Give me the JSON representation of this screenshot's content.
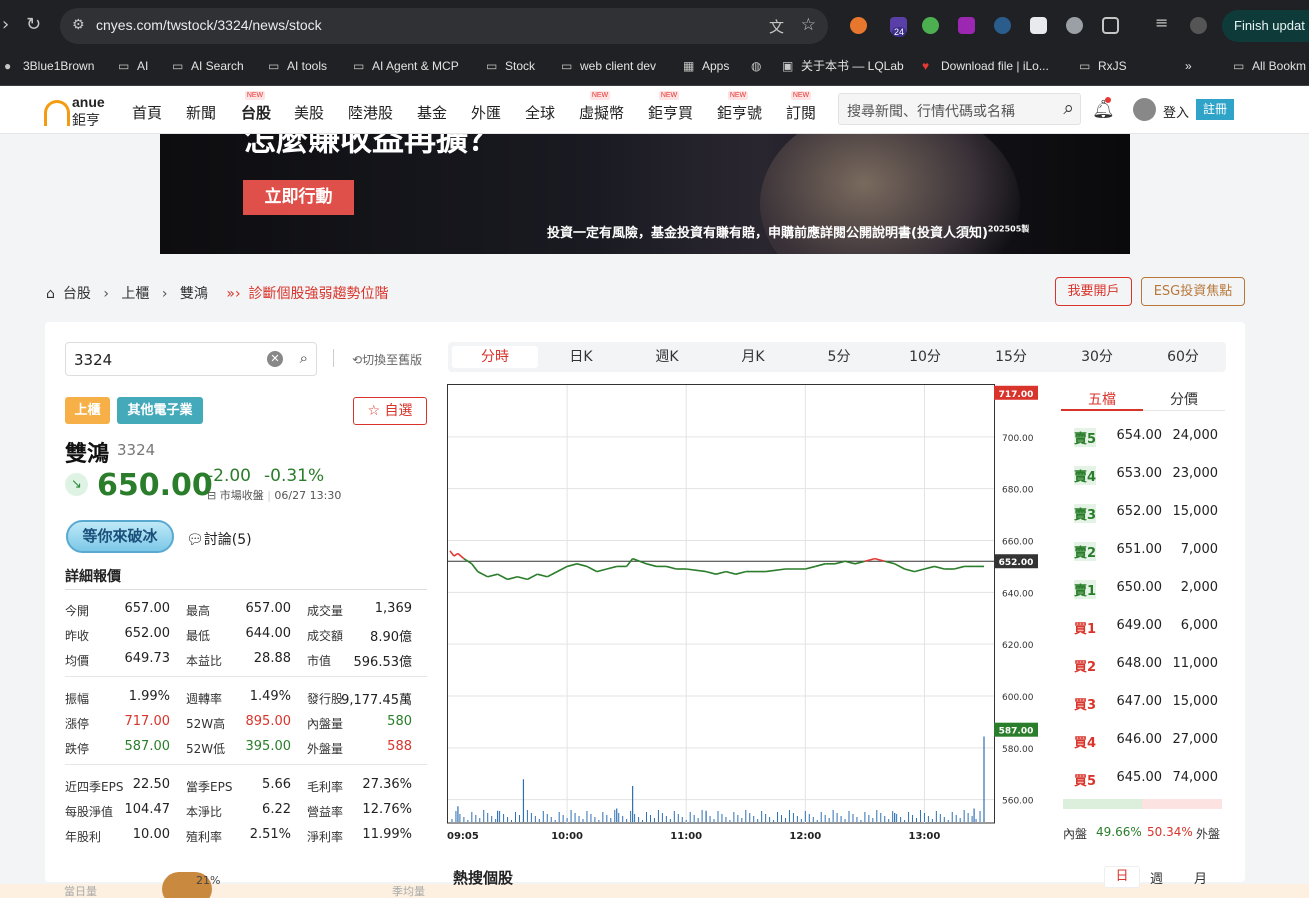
{
  "browser": {
    "url": "cnyes.com/twstock/3324/news/stock",
    "update_label": "Finish updat",
    "extension_badge": "24",
    "bookmarks": [
      "3Blue1Brown",
      "AI",
      "AI Search",
      "AI tools",
      "AI Agent & MCP",
      "Stock",
      "web client dev",
      "Apps",
      "",
      "关于本书 — LQLab",
      "Download file | iLo...",
      "RxJS",
      "»",
      "All Bookm"
    ]
  },
  "header": {
    "logo_top": "anue",
    "logo_bottom": "鉅亨",
    "menu": [
      "首頁",
      "新聞",
      "台股",
      "美股",
      "陸港股",
      "基金",
      "外匯",
      "全球",
      "虛擬幣",
      "鉅亨買",
      "鉅亨號",
      "訂閱"
    ],
    "new_tag": "NEW",
    "search_placeholder": "搜尋新聞、行情代碼或名稱",
    "login": "登入",
    "register": "註冊"
  },
  "banner": {
    "headline_partial": "怎麼賺收益再擴？",
    "cta": "立即行動",
    "disclaimer": "投資一定有風險，基金投資有賺有賠，申購前應詳閱公開說明書(投資人須知)",
    "disclaimer_sup": "202505製"
  },
  "breadcrumb": {
    "items": [
      "台股",
      "上櫃",
      "雙鴻"
    ],
    "diagnose": "診斷個股強弱趨勢位階",
    "open_account": "我要開戶",
    "esg": "ESG投資焦點"
  },
  "stock": {
    "search_value": "3324",
    "switch_old": "切換至舊版",
    "market_tag": "上櫃",
    "industry_tag": "其他電子業",
    "favorite": "自選",
    "name": "雙鴻",
    "code": "3324",
    "price": "650.00",
    "change": "-2.00",
    "change_pct": "-0.31%",
    "status": "市場收盤",
    "time": "06/27 13:30",
    "ice_badge": "等你來破冰",
    "discussion": "討論(5)",
    "detail_title": "詳細報價"
  },
  "quote_rows": [
    [
      [
        "今開",
        "657.00",
        ""
      ],
      [
        "最高",
        "657.00",
        ""
      ],
      [
        "成交量",
        "1,369",
        ""
      ]
    ],
    [
      [
        "昨收",
        "652.00",
        ""
      ],
      [
        "最低",
        "644.00",
        ""
      ],
      [
        "成交額",
        "8.90億",
        ""
      ]
    ],
    [
      [
        "均價",
        "649.73",
        ""
      ],
      [
        "本益比",
        "28.88",
        ""
      ],
      [
        "市值",
        "596.53億",
        ""
      ]
    ],
    [
      [
        "振幅",
        "1.99%",
        ""
      ],
      [
        "週轉率",
        "1.49%",
        ""
      ],
      [
        "發行股",
        "9,177.45萬",
        ""
      ]
    ],
    [
      [
        "漲停",
        "717.00",
        "red"
      ],
      [
        "52W高",
        "895.00",
        "red"
      ],
      [
        "內盤量",
        "580",
        "green"
      ]
    ],
    [
      [
        "跌停",
        "587.00",
        "green"
      ],
      [
        "52W低",
        "395.00",
        "green"
      ],
      [
        "外盤量",
        "588",
        "red"
      ]
    ],
    [
      [
        "近四季EPS",
        "22.50",
        ""
      ],
      [
        "當季EPS",
        "5.66",
        ""
      ],
      [
        "毛利率",
        "27.36%",
        ""
      ]
    ],
    [
      [
        "每股淨值",
        "104.47",
        ""
      ],
      [
        "本淨比",
        "6.22",
        ""
      ],
      [
        "營益率",
        "12.76%",
        ""
      ]
    ],
    [
      [
        "年股利",
        "10.00",
        ""
      ],
      [
        "殖利率",
        "2.51%",
        ""
      ],
      [
        "淨利率",
        "11.99%",
        ""
      ]
    ]
  ],
  "tabs": [
    "分時",
    "日K",
    "週K",
    "月K",
    "5分",
    "10分",
    "15分",
    "30分",
    "60分"
  ],
  "chart_data": {
    "type": "line",
    "x_ticks": [
      "09:05",
      "10:00",
      "11:00",
      "12:00",
      "13:00"
    ],
    "y_ticks": [
      700,
      680,
      660,
      640,
      620,
      600,
      580,
      560
    ],
    "ylim": [
      551,
      720
    ],
    "ref_price": 652,
    "limit_up": 717,
    "limit_down": 587,
    "ref_label": "652.00",
    "limit_up_label": "717.00",
    "limit_down_label": "587.00",
    "y_tick_labels": [
      "700.00",
      "680.00",
      "660.00",
      "640.00",
      "620.00",
      "600.00",
      "580.00",
      "560.00"
    ],
    "price_series": [
      {
        "t": "09:01",
        "v": 656
      },
      {
        "t": "09:03",
        "v": 654
      },
      {
        "t": "09:05",
        "v": 655
      },
      {
        "t": "09:08",
        "v": 653
      },
      {
        "t": "09:12",
        "v": 651
      },
      {
        "t": "09:15",
        "v": 648
      },
      {
        "t": "09:20",
        "v": 646
      },
      {
        "t": "09:25",
        "v": 647
      },
      {
        "t": "09:30",
        "v": 645
      },
      {
        "t": "09:35",
        "v": 646
      },
      {
        "t": "09:40",
        "v": 645
      },
      {
        "t": "09:45",
        "v": 647
      },
      {
        "t": "09:50",
        "v": 646
      },
      {
        "t": "09:55",
        "v": 648
      },
      {
        "t": "10:00",
        "v": 650
      },
      {
        "t": "10:05",
        "v": 651
      },
      {
        "t": "10:10",
        "v": 650
      },
      {
        "t": "10:15",
        "v": 648
      },
      {
        "t": "10:20",
        "v": 649
      },
      {
        "t": "10:25",
        "v": 650
      },
      {
        "t": "10:30",
        "v": 650
      },
      {
        "t": "10:33",
        "v": 653
      },
      {
        "t": "10:40",
        "v": 651
      },
      {
        "t": "10:45",
        "v": 650
      },
      {
        "t": "10:50",
        "v": 650
      },
      {
        "t": "10:55",
        "v": 649
      },
      {
        "t": "11:00",
        "v": 649
      },
      {
        "t": "11:10",
        "v": 648
      },
      {
        "t": "11:15",
        "v": 647
      },
      {
        "t": "11:20",
        "v": 648
      },
      {
        "t": "11:25",
        "v": 647
      },
      {
        "t": "11:30",
        "v": 648
      },
      {
        "t": "11:40",
        "v": 648
      },
      {
        "t": "11:50",
        "v": 649
      },
      {
        "t": "12:00",
        "v": 649
      },
      {
        "t": "12:05",
        "v": 650
      },
      {
        "t": "12:10",
        "v": 651
      },
      {
        "t": "12:15",
        "v": 651
      },
      {
        "t": "12:20",
        "v": 652
      },
      {
        "t": "12:25",
        "v": 651
      },
      {
        "t": "12:30",
        "v": 652
      },
      {
        "t": "12:35",
        "v": 653
      },
      {
        "t": "12:40",
        "v": 652
      },
      {
        "t": "12:45",
        "v": 651
      },
      {
        "t": "12:50",
        "v": 649
      },
      {
        "t": "12:55",
        "v": 648
      },
      {
        "t": "13:00",
        "v": 649
      },
      {
        "t": "13:05",
        "v": 650
      },
      {
        "t": "13:10",
        "v": 649
      },
      {
        "t": "13:15",
        "v": 649
      },
      {
        "t": "13:20",
        "v": 650
      },
      {
        "t": "13:25",
        "v": 650
      },
      {
        "t": "13:30",
        "v": 650
      }
    ],
    "volume_spikes": [
      {
        "t": "09:05",
        "v": 0.35
      },
      {
        "t": "09:25",
        "v": 0.25
      },
      {
        "t": "09:38",
        "v": 0.95
      },
      {
        "t": "10:25",
        "v": 0.3
      },
      {
        "t": "10:33",
        "v": 0.8
      },
      {
        "t": "11:10",
        "v": 0.25
      },
      {
        "t": "12:45",
        "v": 0.2
      },
      {
        "t": "13:25",
        "v": 0.3
      },
      {
        "t": "13:30",
        "v": 1.9
      }
    ],
    "colors": {
      "up": "#e53935",
      "down": "#2a7d2a",
      "ref": "#333333",
      "volume": "#2c6fb3"
    }
  },
  "orderbook": {
    "tab_five": "五檔",
    "tab_price": "分價",
    "sells": [
      [
        "賣5",
        "654.00",
        "24,000"
      ],
      [
        "賣4",
        "653.00",
        "23,000"
      ],
      [
        "賣3",
        "652.00",
        "15,000"
      ],
      [
        "賣2",
        "651.00",
        "7,000"
      ],
      [
        "賣1",
        "650.00",
        "2,000"
      ]
    ],
    "buys": [
      [
        "買1",
        "649.00",
        "6,000"
      ],
      [
        "買2",
        "648.00",
        "11,000"
      ],
      [
        "買3",
        "647.00",
        "15,000"
      ],
      [
        "買4",
        "646.00",
        "27,000"
      ],
      [
        "買5",
        "645.00",
        "74,000"
      ]
    ],
    "in_label": "內盤",
    "in_pct": "49.66%",
    "in_fraction": 0.4966,
    "out_pct": "50.34%",
    "out_label": "外盤"
  },
  "hot": {
    "title": "熱搜個股",
    "day": "日",
    "week": "週",
    "month": "月"
  },
  "footer_partial": {
    "left": "當日量",
    "right": "季均量",
    "cookie_pct": "21%"
  }
}
